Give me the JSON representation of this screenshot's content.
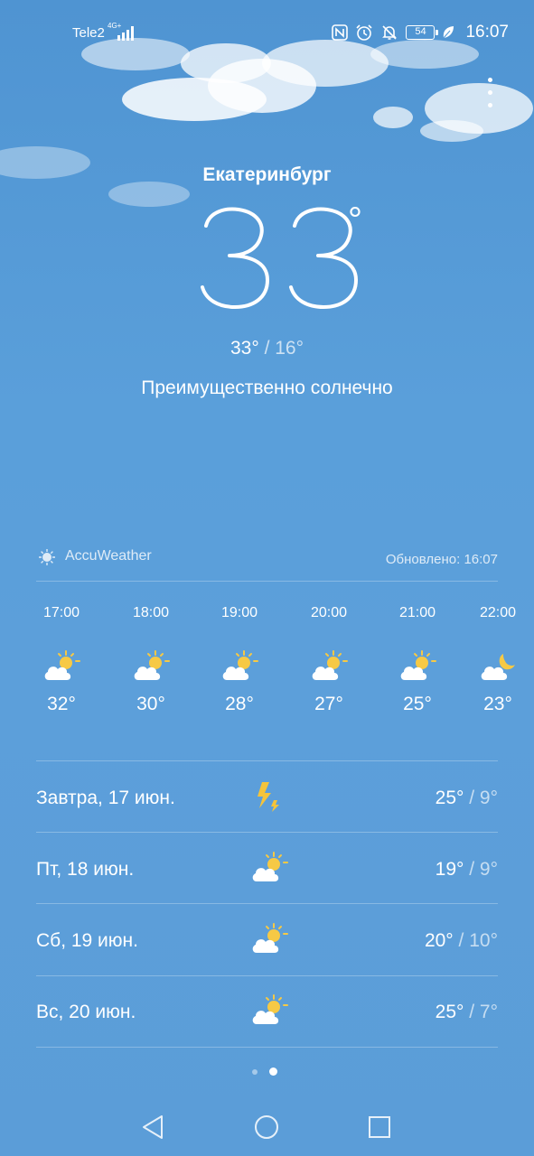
{
  "status_bar": {
    "carrier": "Tele2",
    "network": "4G+",
    "battery": "54",
    "time": "16:07",
    "icons": [
      "nfc-icon",
      "alarm-icon",
      "bell-off-icon",
      "battery-icon",
      "leaf-icon"
    ]
  },
  "location": {
    "city": "Екатеринбург"
  },
  "current": {
    "temperature": "33",
    "degree_symbol": "°",
    "high": "33°",
    "separator": " / ",
    "low": "16°",
    "condition": "Преимущественно солнечно"
  },
  "provider": {
    "name": "AccuWeather",
    "updated": "Обновлено: 16:07"
  },
  "hourly": [
    {
      "time": "17:00",
      "icon": "partly-sunny-icon",
      "temp": "32°"
    },
    {
      "time": "18:00",
      "icon": "partly-sunny-icon",
      "temp": "30°"
    },
    {
      "time": "19:00",
      "icon": "partly-sunny-icon",
      "temp": "28°"
    },
    {
      "time": "20:00",
      "icon": "partly-sunny-icon",
      "temp": "27°"
    },
    {
      "time": "21:00",
      "icon": "partly-sunny-icon",
      "temp": "25°"
    },
    {
      "time": "22:00",
      "icon": "partly-cloudy-night-icon",
      "temp": "23°"
    }
  ],
  "daily": [
    {
      "label": "Завтра, 17 июн.",
      "icon": "thunder-icon",
      "high": "25°",
      "low": "9°"
    },
    {
      "label": "Пт, 18 июн.",
      "icon": "partly-sunny-icon",
      "high": "19°",
      "low": "9°"
    },
    {
      "label": "Сб, 19 июн.",
      "icon": "partly-sunny-icon",
      "high": "20°",
      "low": "10°"
    },
    {
      "label": "Вс, 20 июн.",
      "icon": "partly-sunny-icon",
      "high": "25°",
      "low": "7°"
    }
  ],
  "pager": {
    "count": 2,
    "active": 1
  },
  "colors": {
    "sky": "#5a9fda",
    "sun": "#f6c945",
    "bolt": "#f5c43a"
  }
}
